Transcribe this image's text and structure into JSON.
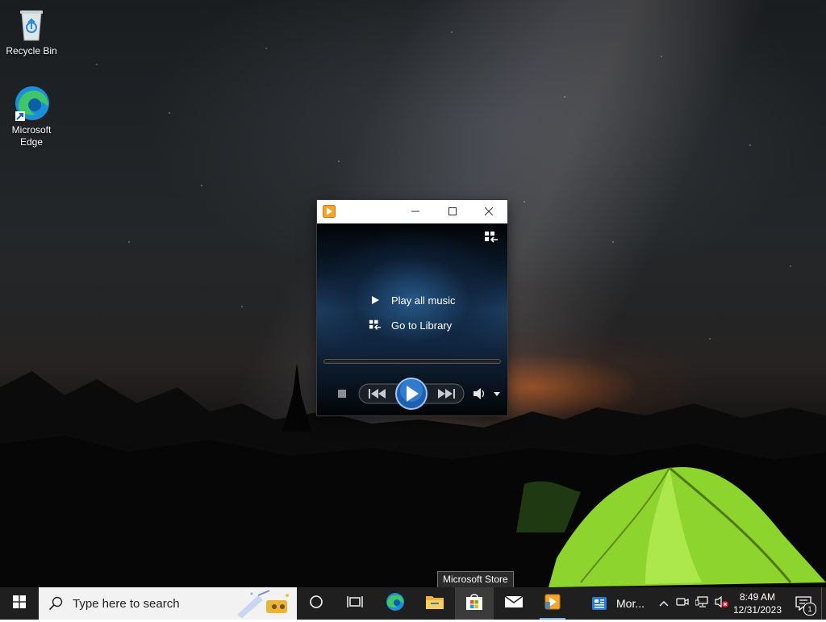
{
  "desktop": {
    "icons": [
      {
        "label": "Recycle Bin",
        "icon": "recycle-bin-icon"
      },
      {
        "label": "Microsoft Edge",
        "icon": "edge-icon"
      }
    ]
  },
  "media_player": {
    "app_icon": "media-player-icon",
    "controls": {
      "minimize": "minimize-icon",
      "maximize": "maximize-icon",
      "close": "close-icon"
    },
    "menu": {
      "play_all": "Play all music",
      "go_to_library": "Go to Library"
    }
  },
  "tooltip": {
    "text": "Microsoft Store"
  },
  "taskbar": {
    "search_placeholder": "Type here to search",
    "apps": [
      "cortana-icon",
      "task-view-icon",
      "edge-icon",
      "file-explorer-icon",
      "microsoft-store-icon",
      "mail-icon",
      "media-player-icon",
      "news-icon"
    ],
    "news_label": "Mor...",
    "clock": {
      "time": "8:49 AM",
      "date": "12/31/2023"
    },
    "notification_count": "1"
  },
  "colors": {
    "taskbar": "#1f1f1f",
    "accent_underline": "#7fb2e5",
    "tent_green": "#9be23a"
  }
}
